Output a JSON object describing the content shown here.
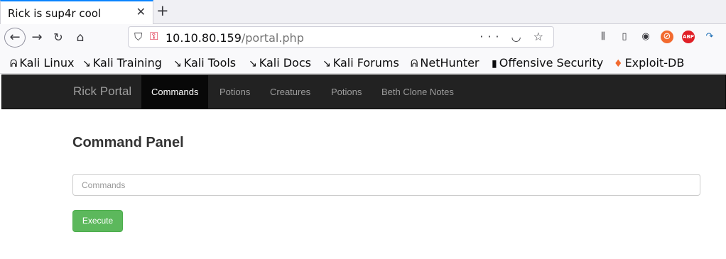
{
  "browser": {
    "tab": {
      "title": "Rick is sup4r cool",
      "close_icon": "close-icon"
    },
    "new_tab_icon": "plus-icon",
    "url": {
      "host": "10.10.80.159",
      "path": "/portal.php"
    },
    "bookmarks": [
      {
        "label": "Kali Linux",
        "icon": "kali-dragon-icon"
      },
      {
        "label": "Kali Training",
        "icon": "kali-knife-icon"
      },
      {
        "label": "Kali Tools",
        "icon": "kali-knife-icon"
      },
      {
        "label": "Kali Docs",
        "icon": "kali-knife-icon"
      },
      {
        "label": "Kali Forums",
        "icon": "kali-knife-icon"
      },
      {
        "label": "NetHunter",
        "icon": "kali-dragon-icon"
      },
      {
        "label": "Offensive Security",
        "icon": "offsec-icon"
      },
      {
        "label": "Exploit-DB",
        "icon": "exploitdb-icon"
      }
    ],
    "extension_badges": {
      "abp": "ABP"
    }
  },
  "site": {
    "brand": "Rick Portal",
    "nav": [
      {
        "label": "Commands",
        "active": true
      },
      {
        "label": "Potions",
        "active": false
      },
      {
        "label": "Creatures",
        "active": false
      },
      {
        "label": "Potions",
        "active": false
      },
      {
        "label": "Beth Clone Notes",
        "active": false
      }
    ]
  },
  "main": {
    "title": "Command Panel",
    "input": {
      "placeholder": "Commands",
      "value": ""
    },
    "execute_label": "Execute"
  },
  "colors": {
    "navbar_bg": "#222222",
    "active_nav_bg": "#080808",
    "execute_button": "#5cb85c",
    "tab_accent": "#0a84ff",
    "insecure_lock": "#d70022"
  }
}
